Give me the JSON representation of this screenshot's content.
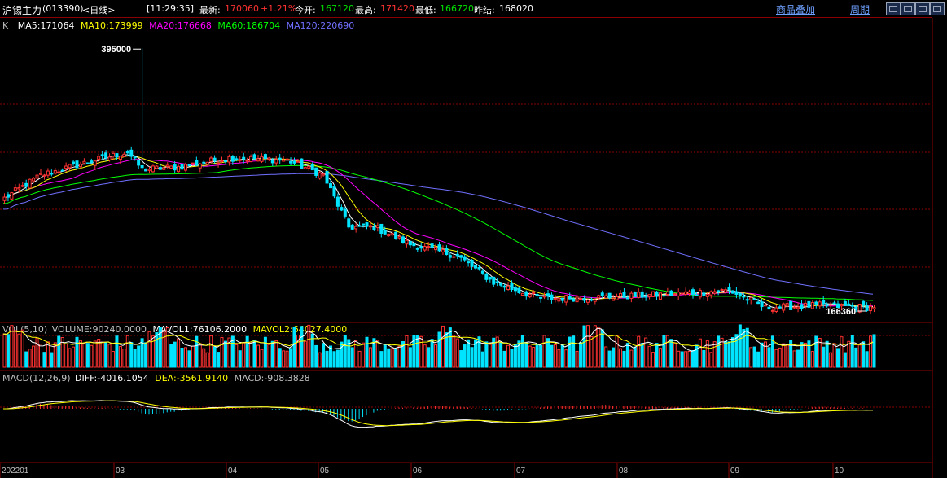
{
  "header": {
    "instrument": "沪锡主力",
    "code": "(013390)",
    "period_label": "<日线>",
    "time": "[11:29:35]",
    "latest_label": "最新:",
    "latest_value": "170060",
    "change_pct": "+1.21%",
    "open_label": "今开:",
    "open_value": "167120",
    "high_label": "最高:",
    "high_value": "171420",
    "low_label": "最低:",
    "low_value": "166720",
    "prev_close_label": "昨结:",
    "prev_close_value": "168020",
    "overlay_link": "商品叠加",
    "period_link": "周期"
  },
  "colors": {
    "up": "#ff3232",
    "down": "#00e4ff",
    "ma5": "#ffffff",
    "ma10": "#ffff00",
    "ma20": "#ff00ff",
    "ma60": "#00ff00",
    "ma120": "#7070ff",
    "grid": "#8a0000",
    "label_gray": "#c0c0c0"
  },
  "price_panel": {
    "k_label": "K",
    "ma5": "MA5:171064",
    "ma10": "MA10:173999",
    "ma20": "MA20:176668",
    "ma60": "MA60:186704",
    "ma120": "MA120:220690",
    "max_annotation": "395000",
    "min_annotation": "166360"
  },
  "vol_panel": {
    "label": "VOL(5,10)",
    "volume": "VOLUME:90240.0000",
    "mavol1": "MAVOL1:76106.2000",
    "mavol2": "MAVOL2:64027.4000"
  },
  "macd_panel": {
    "label": "MACD(12,26,9)",
    "diff": "DIFF:-4016.1054",
    "dea": "DEA:-3561.9140",
    "macd": "MACD:-908.3828"
  },
  "x_axis": {
    "labels": [
      "202201",
      "03",
      "04",
      "05",
      "06",
      "07",
      "08",
      "09",
      "10"
    ]
  },
  "chart_data": {
    "type": "candlestick",
    "price_range": [
      160000,
      410000
    ],
    "max_high": 395000,
    "min_low": 166360,
    "months": [
      "202201",
      "03",
      "04",
      "05",
      "06",
      "07",
      "08",
      "09",
      "10"
    ],
    "close_anchors": [
      {
        "bar": 0,
        "value": 265000
      },
      {
        "bar": 10,
        "value": 285000
      },
      {
        "bar": 25,
        "value": 298000
      },
      {
        "bar": 34,
        "value": 305000
      },
      {
        "bar": 38,
        "value": 290000
      },
      {
        "bar": 48,
        "value": 292000
      },
      {
        "bar": 62,
        "value": 300000
      },
      {
        "bar": 78,
        "value": 298000
      },
      {
        "bar": 88,
        "value": 285000
      },
      {
        "bar": 95,
        "value": 240000
      },
      {
        "bar": 102,
        "value": 240000
      },
      {
        "bar": 112,
        "value": 225000
      },
      {
        "bar": 125,
        "value": 215000
      },
      {
        "bar": 135,
        "value": 192000
      },
      {
        "bar": 148,
        "value": 178000
      },
      {
        "bar": 165,
        "value": 179000
      },
      {
        "bar": 185,
        "value": 182000
      },
      {
        "bar": 200,
        "value": 185000
      },
      {
        "bar": 210,
        "value": 170000
      },
      {
        "bar": 225,
        "value": 172000
      },
      {
        "bar": 240,
        "value": 170060
      }
    ],
    "ma_last": {
      "MA5": 171064,
      "MA10": 173999,
      "MA20": 176668,
      "MA60": 186704,
      "MA120": 220690
    },
    "vol_last": {
      "VOLUME": 90240,
      "MAVOL1": 76106.2,
      "MAVOL2": 64027.4
    },
    "macd_last": {
      "DIFF": -4016.1054,
      "DEA": -3561.914,
      "MACD": -908.3828
    }
  }
}
